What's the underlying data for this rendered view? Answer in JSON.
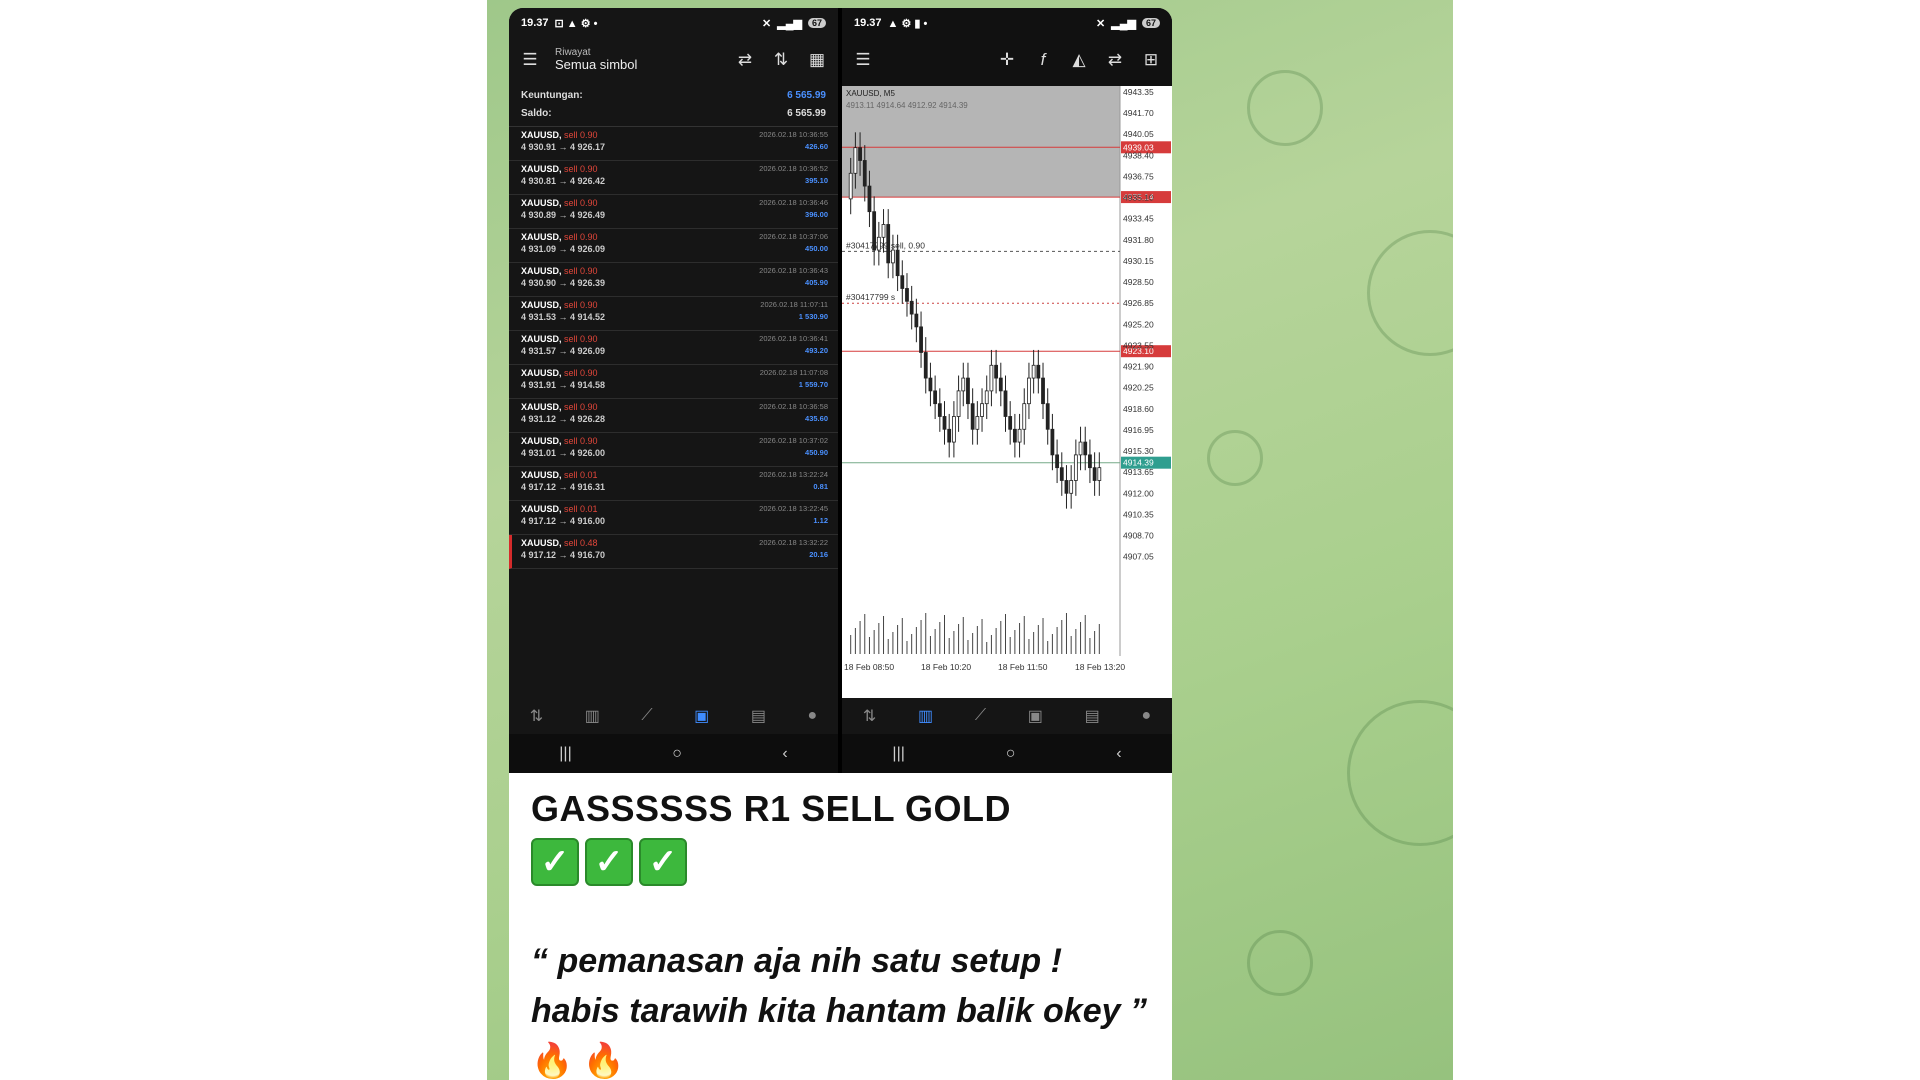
{
  "status_time": "19.37",
  "battery": "67",
  "left": {
    "title_small": "Riwayat",
    "title_main": "Semua simbol",
    "summary": [
      {
        "label": "Keuntungan:",
        "value": "6 565.99",
        "color": "#4a90ff"
      },
      {
        "label": "Saldo:",
        "value": "6 565.99",
        "color": "#dddddd"
      }
    ],
    "deals": [
      {
        "symbol": "XAUUSD,",
        "action": "sell 0.90",
        "prices": "4 930.91 → 4 926.17",
        "time": "2026.02.18 10:36:55",
        "profit": "426.60"
      },
      {
        "symbol": "XAUUSD,",
        "action": "sell 0.90",
        "prices": "4 930.81 → 4 926.42",
        "time": "2026.02.18 10:36:52",
        "profit": "395.10"
      },
      {
        "symbol": "XAUUSD,",
        "action": "sell 0.90",
        "prices": "4 930.89 → 4 926.49",
        "time": "2026.02.18 10:36:46",
        "profit": "396.00"
      },
      {
        "symbol": "XAUUSD,",
        "action": "sell 0.90",
        "prices": "4 931.09 → 4 926.09",
        "time": "2026.02.18 10:37:06",
        "profit": "450.00"
      },
      {
        "symbol": "XAUUSD,",
        "action": "sell 0.90",
        "prices": "4 930.90 → 4 926.39",
        "time": "2026.02.18 10:36:43",
        "profit": "405.90"
      },
      {
        "symbol": "XAUUSD,",
        "action": "sell 0.90",
        "prices": "4 931.53 → 4 914.52",
        "time": "2026.02.18 11:07:11",
        "profit": "1 530.90"
      },
      {
        "symbol": "XAUUSD,",
        "action": "sell 0.90",
        "prices": "4 931.57 → 4 926.09",
        "time": "2026.02.18 10:36:41",
        "profit": "493.20"
      },
      {
        "symbol": "XAUUSD,",
        "action": "sell 0.90",
        "prices": "4 931.91 → 4 914.58",
        "time": "2026.02.18 11:07:08",
        "profit": "1 559.70"
      },
      {
        "symbol": "XAUUSD,",
        "action": "sell 0.90",
        "prices": "4 931.12 → 4 926.28",
        "time": "2026.02.18 10:36:58",
        "profit": "435.60"
      },
      {
        "symbol": "XAUUSD,",
        "action": "sell 0.90",
        "prices": "4 931.01 → 4 926.00",
        "time": "2026.02.18 10:37:02",
        "profit": "450.90"
      },
      {
        "symbol": "XAUUSD,",
        "action": "sell 0.01",
        "prices": "4 917.12 → 4 916.31",
        "time": "2026.02.18 13:22:24",
        "profit": "0.81"
      },
      {
        "symbol": "XAUUSD,",
        "action": "sell 0.01",
        "prices": "4 917.12 → 4 916.00",
        "time": "2026.02.18 13:22:45",
        "profit": "1.12"
      },
      {
        "symbol": "XAUUSD,",
        "action": "sell 0.48",
        "prices": "4 917.12 → 4 916.70",
        "time": "2026.02.18 13:32:22",
        "profit": "20.16"
      }
    ]
  },
  "right": {
    "symbol": "XAUUSD, M5",
    "ohlc": "4913.11 4914.64 4912.92 4914.39",
    "order_label_1": "#30417799 sell, 0.90",
    "order_label_2": "#30417799 s",
    "price_labels": [
      "4943.35",
      "4941.70",
      "4940.05",
      "4938.40",
      "4936.75",
      "4935.10",
      "4933.45",
      "4931.80",
      "4930.15",
      "4928.50",
      "4926.85",
      "4925.20",
      "4923.55",
      "4921.90",
      "4920.25",
      "4918.60",
      "4916.95",
      "4915.30",
      "4913.65",
      "4912.00",
      "4910.35",
      "4908.70",
      "4907.05"
    ],
    "marker_red_1": "4939.03",
    "marker_red_2": "4935.14",
    "marker_red_3": "4923.10",
    "marker_green": "4914.39",
    "time_labels": [
      "18 Feb 08:50",
      "18 Feb 10:20",
      "18 Feb 11:50",
      "18 Feb 13:20"
    ],
    "colors": {
      "red_line": "#d63b3b",
      "grey_zone": "#b5b5b5",
      "green_marker": "#2f9e8f",
      "candle": "#222222"
    }
  },
  "left_nav_icons": [
    "quotes-icon",
    "chart-icon",
    "trade-icon",
    "history-icon",
    "news-icon",
    "chat-icon"
  ],
  "right_nav_icons": [
    "quotes-icon",
    "chart-icon",
    "trade-icon",
    "history-icon",
    "news-icon",
    "chat-icon"
  ],
  "caption": {
    "title": "GASSSSSS R1 SELL GOLD",
    "checks": [
      "✓",
      "✓",
      "✓"
    ],
    "quote_text": "“ pemanasan aja nih satu setup ! habis tarawih kita hantam balik okey ”",
    "fire": "🔥 🔥"
  }
}
